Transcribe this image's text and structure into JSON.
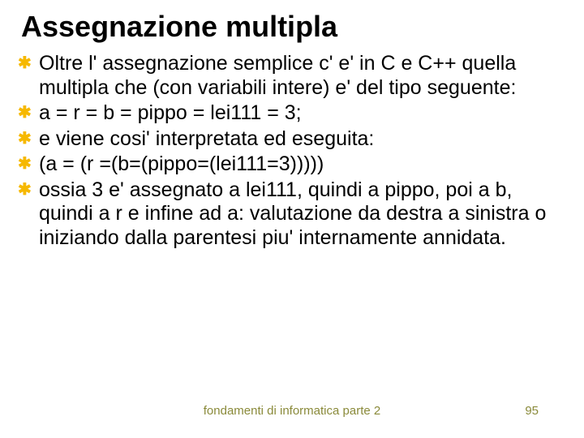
{
  "title": "Assegnazione multipla",
  "bullets": [
    "Oltre l' assegnazione semplice c' e' in C e C++ quella multipla che (con variabili intere) e' del tipo seguente:",
    "a = r = b = pippo = lei111 = 3;",
    "e viene cosi' interpretata ed eseguita:",
    "(a = (r =(b=(pippo=(lei111=3)))))",
    "ossia 3 e' assegnato a lei111, quindi a pippo, poi a b, quindi a r e infine ad a: valutazione da destra a sinistra o iniziando dalla parentesi piu' internamente annidata."
  ],
  "footer_center": "fondamenti di informatica parte 2",
  "footer_page": "95",
  "bullet_glyph": "✱"
}
